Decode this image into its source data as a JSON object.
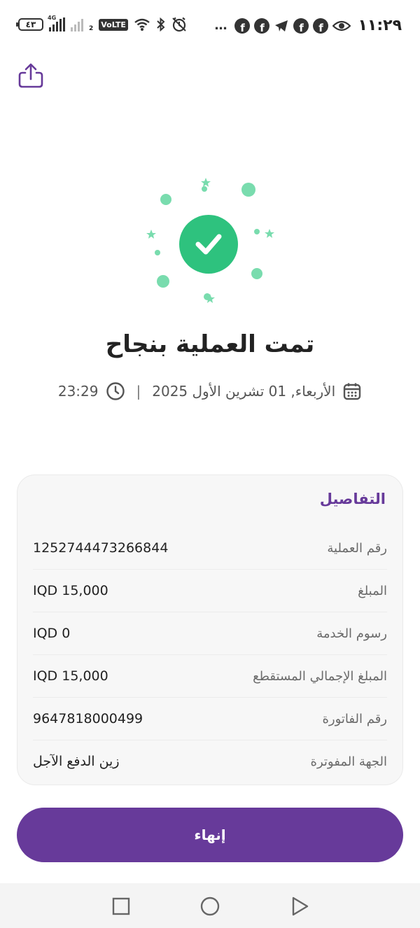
{
  "status_bar": {
    "battery": "٤٣",
    "network": "4G",
    "volte": "VoLTE",
    "sim2": "2",
    "time": "١١:٢٩",
    "overflow": "…",
    "icons": [
      "signal-icon",
      "wifi-icon",
      "bluetooth-icon",
      "alarm-icon",
      "facebook-icon",
      "telegram-icon",
      "eye-icon"
    ]
  },
  "header": {
    "share_icon": "share-icon"
  },
  "success": {
    "title": "تمت العملية بنجاح",
    "date": "الأربعاء, 01 تشرين الأول 2025",
    "separator": "|",
    "time": "23:29",
    "accent": "#2ec27e"
  },
  "details": {
    "title": "التفاصيل",
    "rows": [
      {
        "label": "رقم العملية",
        "value": "1252744473266844"
      },
      {
        "label": "المبلغ",
        "value": "IQD 15,000"
      },
      {
        "label": "رسوم الخدمة",
        "value": "IQD 0"
      },
      {
        "label": "المبلغ الإجمالي المستقطع",
        "value": "IQD 15,000"
      },
      {
        "label": "رقم الفاتورة",
        "value": "9647818000499"
      },
      {
        "label": "الجهة المفوترة",
        "value": "زين الدفع الآجل"
      }
    ]
  },
  "finish_button": {
    "label": "إنهاء",
    "color": "#673a9a"
  },
  "nav": {
    "icons": [
      "square-recents-icon",
      "circle-home-icon",
      "triangle-back-icon"
    ]
  }
}
